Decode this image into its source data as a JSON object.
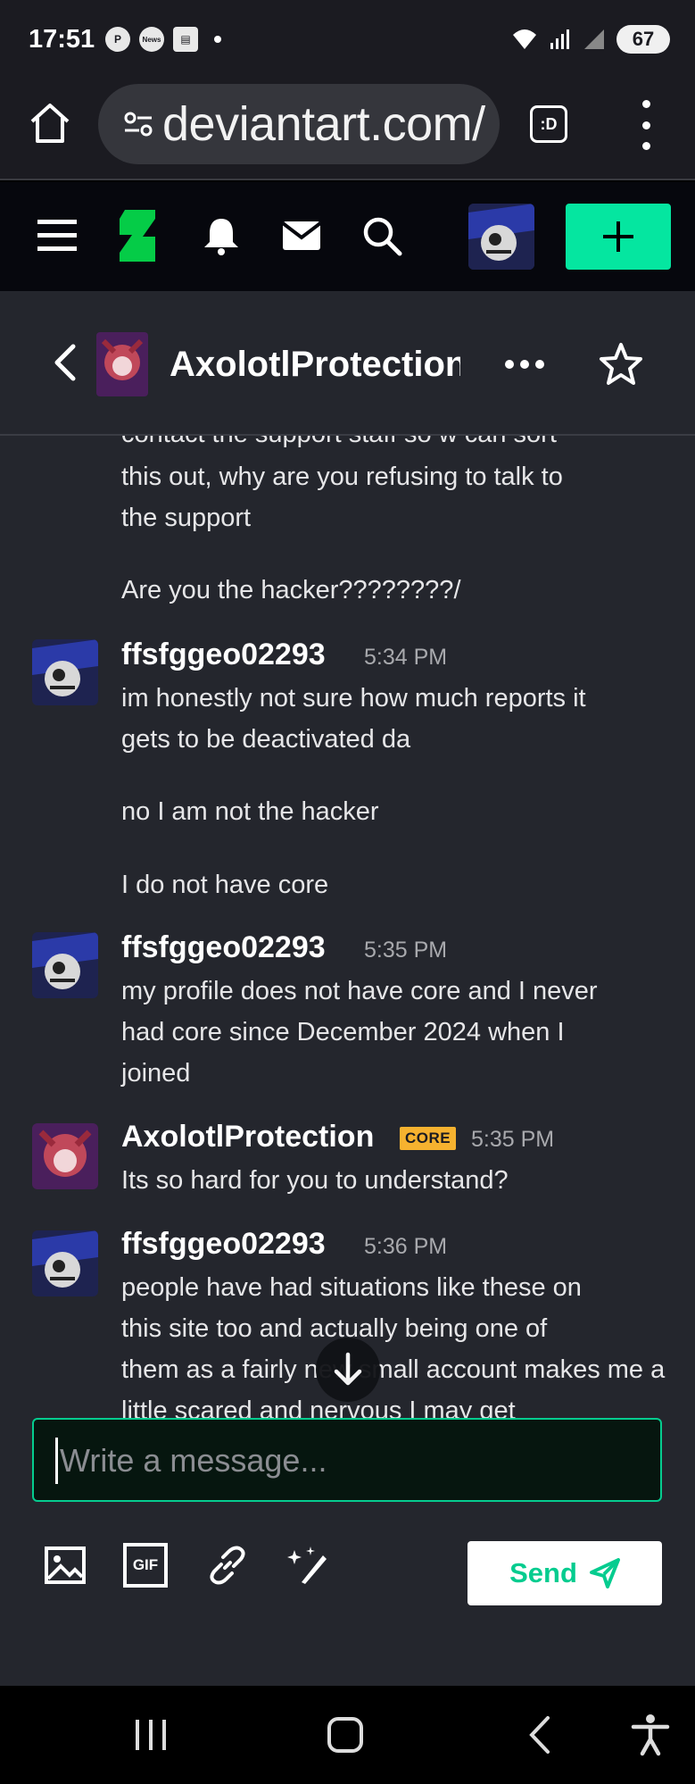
{
  "status_bar": {
    "time": "17:51",
    "notif_icons": [
      "pinterest-icon",
      "news-icon",
      "calendar-icon"
    ],
    "news_label": "News",
    "battery": "67"
  },
  "browser": {
    "url": "deviantart.com/",
    "tabs_label": ":D"
  },
  "conversation": {
    "title": "AxolotlProtection"
  },
  "messages": {
    "cont_line1": "contact the support staff so w can sort",
    "cont_line2": "this out, why are you refusing to talk to",
    "cont_line3": "the support",
    "cont_line4": "Are you the hacker????????/",
    "groups": [
      {
        "user": "ffsfggeo02293",
        "time": "5:34 PM",
        "lines": [
          "im honestly not sure how much reports it",
          "gets to be deactivated da",
          "no I am not the hacker",
          "I do not have core"
        ]
      },
      {
        "user": "ffsfggeo02293",
        "time": "5:35 PM",
        "lines": [
          "my profile does not have core and I never",
          "had core since December 2024 when I",
          "joined"
        ]
      },
      {
        "user": "AxolotlProtection",
        "badge": "CORE",
        "time": "5:35 PM",
        "lines": [
          "Its so hard for you to understand?"
        ]
      },
      {
        "user": "ffsfggeo02293",
        "time": "5:36 PM",
        "lines": [
          "people have had situations like these on",
          "this site too and actually being one of",
          "them as a fairly new small account makes me a",
          "little scared and nervous I may get"
        ]
      }
    ]
  },
  "composer": {
    "placeholder": "Write a message...",
    "gif_label": "GIF",
    "send_label": "Send"
  },
  "colors": {
    "accent": "#05e6a0",
    "core_badge": "#f6b22f",
    "panel": "#24262d"
  }
}
